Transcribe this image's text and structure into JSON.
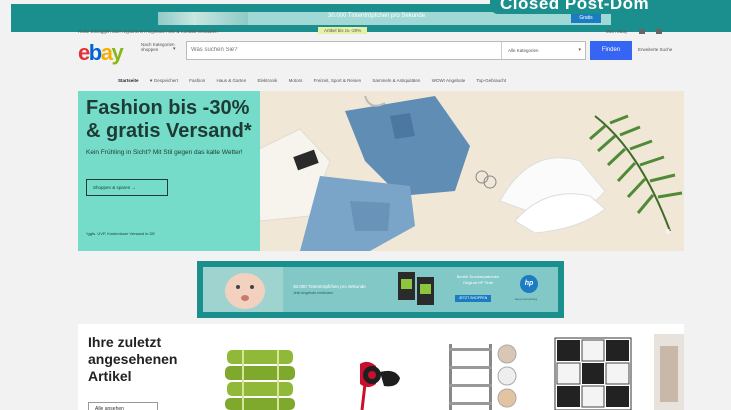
{
  "overlay": {
    "label": "Closed Post-Dom",
    "banner_text": "30.000 Tintentröpfchen pro Sekunde",
    "banner_cta": "Gratis"
  },
  "header": {
    "util_left": "Hallo! Einloggen oder registrieren   Angebote   Hilfe & Kontakt   Verkaufen",
    "util_promo": "Artikel bis zu -20%",
    "util_right": "Mein eBay",
    "logo": {
      "e": "e",
      "b": "b",
      "a": "a",
      "y": "y"
    },
    "category_dropdown": "Nach Kategorien shoppen",
    "search_placeholder": "Was suchen Sie?",
    "search_category": "Alle Kategorien",
    "find_button": "Finden",
    "advanced_link": "Erweiterte Suche"
  },
  "nav": {
    "items": [
      "Startseite",
      "♥ Gespeichert",
      "Fashion",
      "Haus & Garten",
      "Elektronik",
      "Motors",
      "Freizeit, Sport & Reisen",
      "Sammeln & Antiquitäten",
      "WOW! Angebote",
      "Top-Gebraucht"
    ]
  },
  "hero": {
    "title": "Fashion bis -30% & gratis Versand*",
    "subtitle": "Kein Frühling in Sicht? Mit Stil gegen das kalte Wetter!",
    "button": "Shoppen & sparen →",
    "footnote": "*ggfs. UVP, Kostenloser Versand in DE",
    "pause": "II"
  },
  "ad": {
    "line1": "30.000 Tintentröpfchen pro Sekunde",
    "line2": "Jetzt Angebote entdecken",
    "line3": "Bereit! Druckerpatronen Original HP Tinte",
    "cta": "JETZT SHOPPEN",
    "brand": "hp",
    "tagline": "keep reinventing"
  },
  "recent": {
    "title": "Ihre zuletzt angesehenen Artikel",
    "button": "Alle ansehen"
  }
}
